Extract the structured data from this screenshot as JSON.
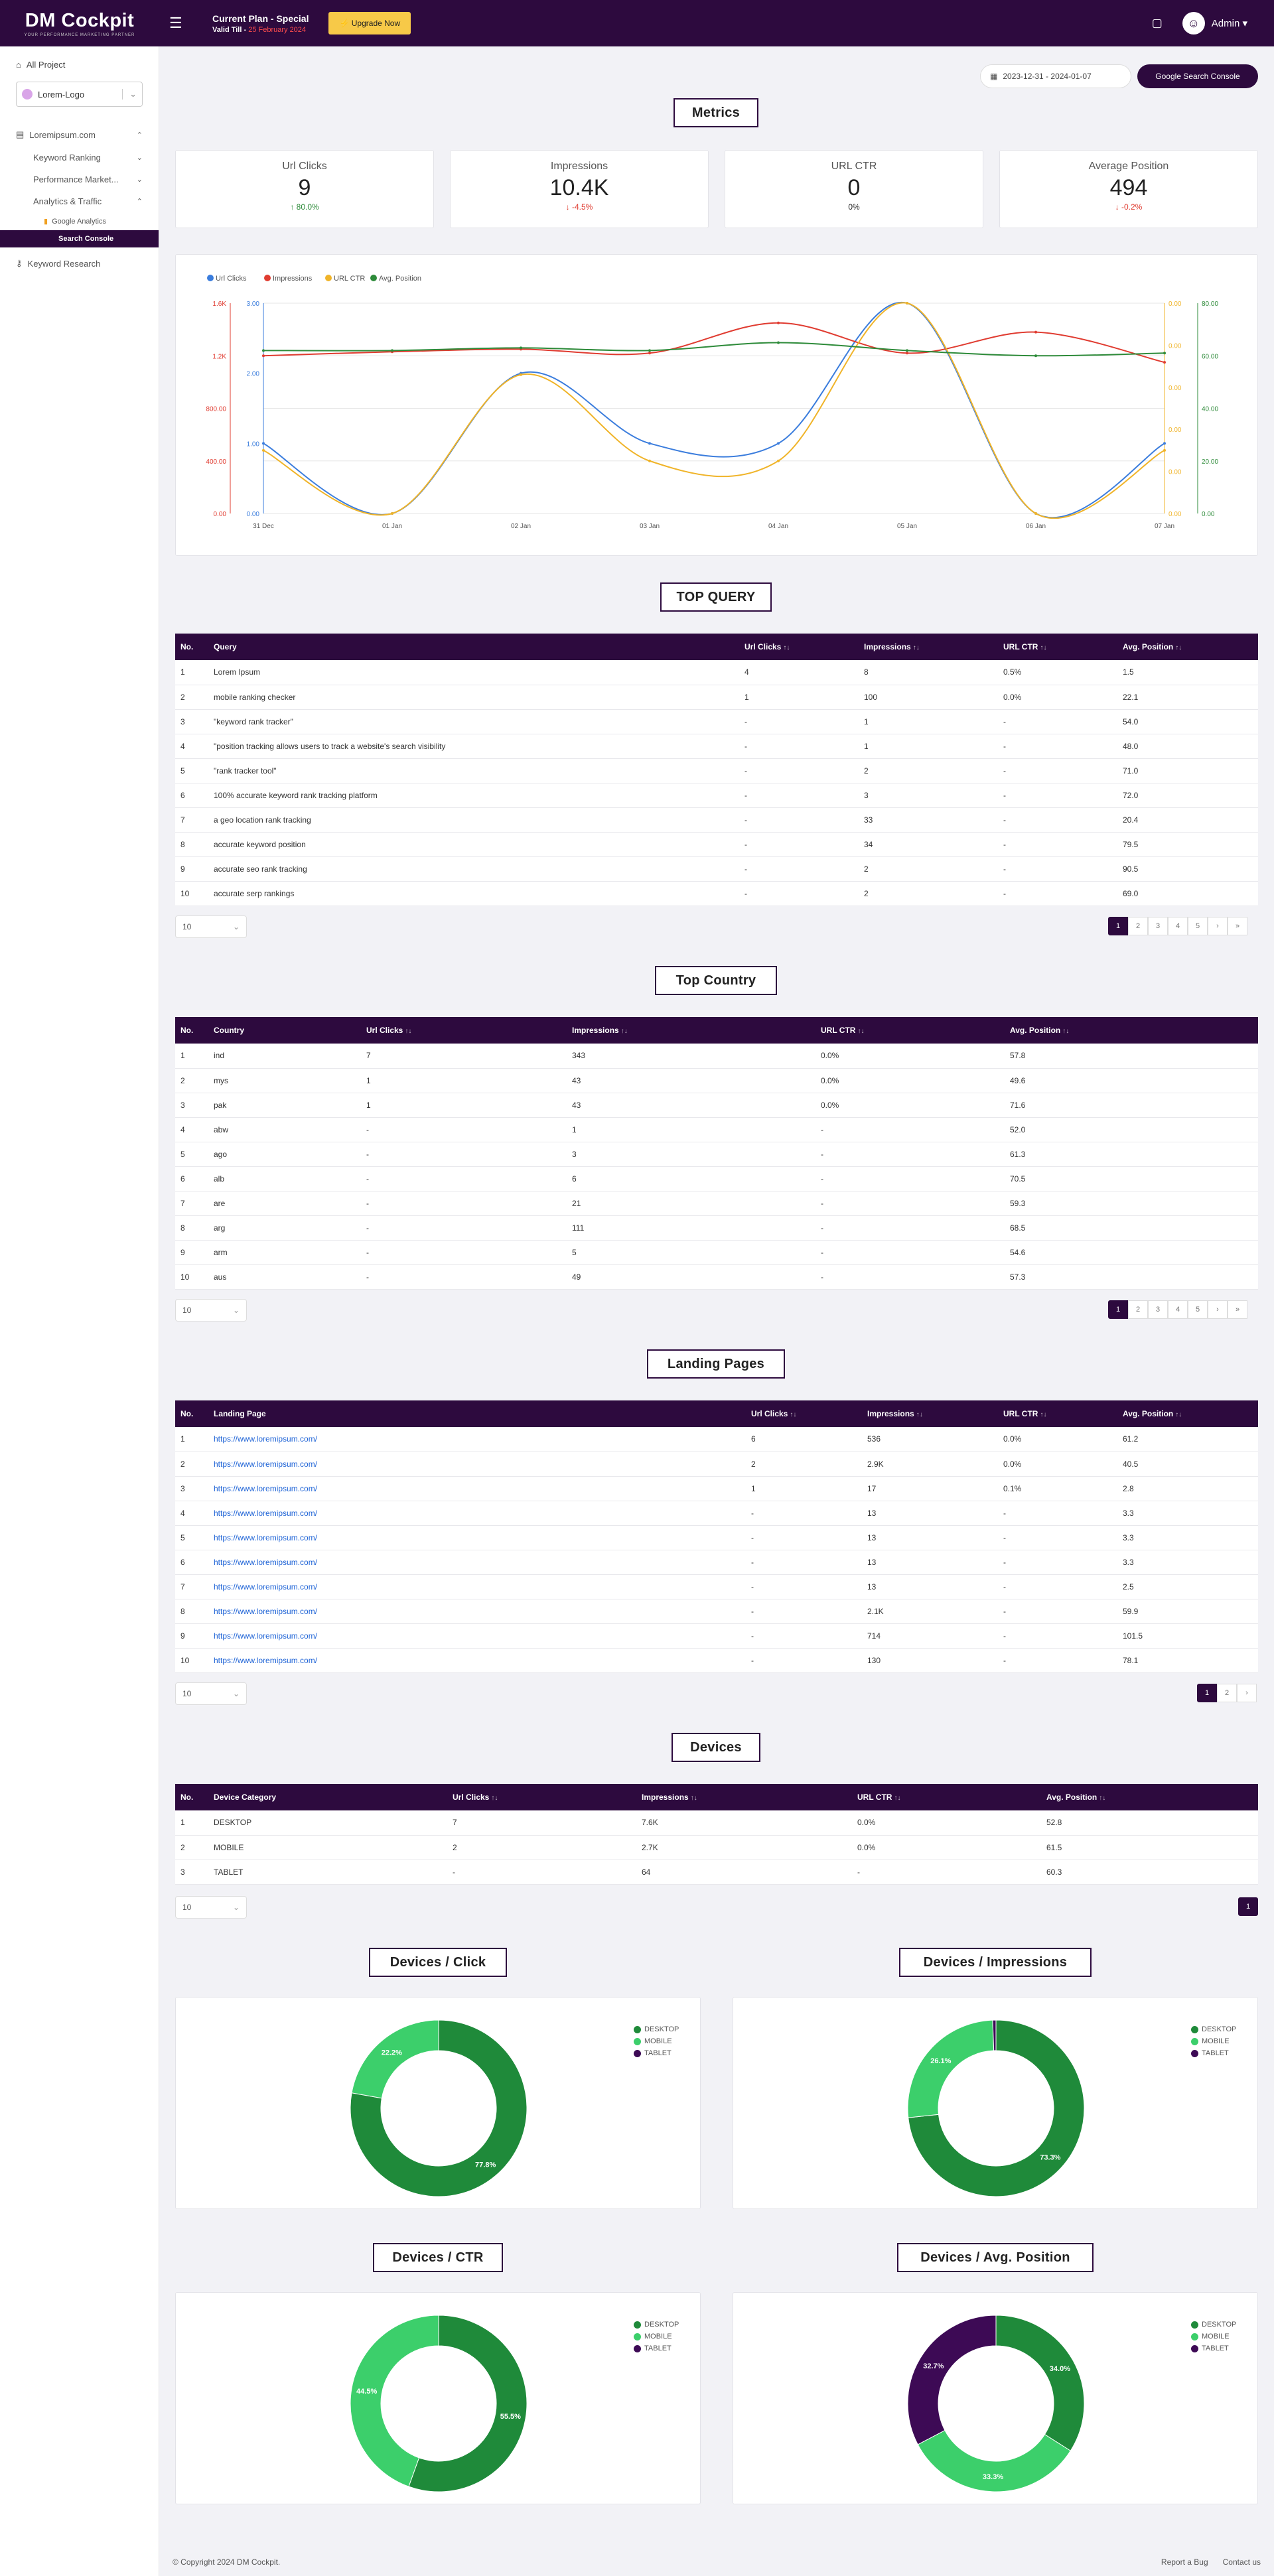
{
  "brand": {
    "name": "DM Cockpit",
    "tagline": "YOUR PERFORMANCE MARKETING PARTNER"
  },
  "header": {
    "plan_title": "Current Plan - Special",
    "valid_label": "Valid Till - ",
    "valid_date": "25 February 2024",
    "upgrade_label": "Upgrade Now",
    "message_icon": "chat-icon",
    "user": "Admin"
  },
  "sidebar": {
    "all_project": "All Project",
    "project_select": "Lorem-Logo",
    "site": "Loremipsum.com",
    "keyword_ranking": "Keyword Ranking",
    "performance_marketing": "Performance Market...",
    "analytics_traffic": "Analytics & Traffic",
    "google_analytics": "Google Analytics",
    "search_console": "Search Console",
    "keyword_research": "Keyword Research"
  },
  "toolbar": {
    "date_range": "2023-12-31 - 2024-01-07",
    "gsc_button": "Google Search Console"
  },
  "metrics": {
    "title": "Metrics",
    "items": [
      {
        "label": "Url Clicks",
        "value": "9",
        "change": "80.0%",
        "dir": "up"
      },
      {
        "label": "Impressions",
        "value": "10.4K",
        "change": "-4.5%",
        "dir": "down"
      },
      {
        "label": "URL CTR",
        "value": "0",
        "change": "0%",
        "dir": "flat"
      },
      {
        "label": "Average Position",
        "value": "494",
        "change": "-0.2%",
        "dir": "down"
      }
    ]
  },
  "chart_data": {
    "type": "line",
    "x": [
      "31 Dec",
      "01 Jan",
      "02 Jan",
      "03 Jan",
      "04 Jan",
      "05 Jan",
      "06 Jan",
      "07 Jan"
    ],
    "series": [
      {
        "name": "Url Clicks",
        "color": "#3b7ddd",
        "axis": "y1",
        "values": [
          1,
          0,
          2,
          1,
          1,
          3,
          0,
          1
        ]
      },
      {
        "name": "Impressions",
        "color": "#e03c31",
        "axis": "y0",
        "values": [
          1200,
          1230,
          1250,
          1220,
          1450,
          1220,
          1380,
          1150
        ]
      },
      {
        "name": "URL CTR",
        "color": "#f0b429",
        "axis": "y2",
        "values": [
          0.003,
          0,
          0.0066,
          0.0025,
          0.0025,
          0.01,
          0,
          0.003
        ]
      },
      {
        "name": "Avg. Position",
        "color": "#2e8b3a",
        "axis": "y3",
        "values": [
          62,
          62,
          63,
          62,
          65,
          62,
          60,
          61
        ]
      }
    ],
    "axes": {
      "y0": {
        "ticks": [
          "0.00",
          "400.00",
          "800.00",
          "1.2K",
          "1.6K"
        ],
        "max": 1600,
        "color": "#e03c31"
      },
      "y1": {
        "ticks": [
          "0.00",
          "1.00",
          "2.00",
          "3.00"
        ],
        "max": 3,
        "color": "#3b7ddd"
      },
      "y2": {
        "ticks": [
          "0.00",
          "0.00",
          "0.00",
          "0.00",
          "0.00",
          "0.00"
        ],
        "max": 0.01,
        "color": "#f0b429"
      },
      "y3": {
        "ticks": [
          "0.00",
          "20.00",
          "40.00",
          "60.00",
          "80.00"
        ],
        "max": 80,
        "color": "#2e8b3a"
      }
    },
    "grid": true,
    "legend": "top-left"
  },
  "top_query": {
    "title": "TOP QUERY",
    "columns": [
      "No.",
      "Query",
      "Url Clicks",
      "Impressions",
      "URL CTR",
      "Avg. Position"
    ],
    "rows": [
      [
        "1",
        "Lorem Ipsum",
        "4",
        "8",
        "0.5%",
        "1.5"
      ],
      [
        "2",
        "mobile ranking checker",
        "1",
        "100",
        "0.0%",
        "22.1"
      ],
      [
        "3",
        "\"keyword rank tracker\"",
        "-",
        "1",
        "-",
        "54.0"
      ],
      [
        "4",
        "\"position tracking allows users to track a website's search visibility",
        "-",
        "1",
        "-",
        "48.0"
      ],
      [
        "5",
        "\"rank tracker tool\"",
        "-",
        "2",
        "-",
        "71.0"
      ],
      [
        "6",
        "100% accurate keyword rank tracking platform",
        "-",
        "3",
        "-",
        "72.0"
      ],
      [
        "7",
        "a geo location rank tracking",
        "-",
        "33",
        "-",
        "20.4"
      ],
      [
        "8",
        "accurate keyword position",
        "-",
        "34",
        "-",
        "79.5"
      ],
      [
        "9",
        "accurate seo rank tracking",
        "-",
        "2",
        "-",
        "90.5"
      ],
      [
        "10",
        "accurate serp rankings",
        "-",
        "2",
        "-",
        "69.0"
      ]
    ],
    "page_size": "10",
    "pages": [
      "1",
      "2",
      "3",
      "4",
      "5",
      "›",
      "»"
    ]
  },
  "top_country": {
    "title": "Top Country",
    "columns": [
      "No.",
      "Country",
      "Url Clicks",
      "Impressions",
      "URL CTR",
      "Avg. Position"
    ],
    "rows": [
      [
        "1",
        "ind",
        "7",
        "343",
        "0.0%",
        "57.8"
      ],
      [
        "2",
        "mys",
        "1",
        "43",
        "0.0%",
        "49.6"
      ],
      [
        "3",
        "pak",
        "1",
        "43",
        "0.0%",
        "71.6"
      ],
      [
        "4",
        "abw",
        "-",
        "1",
        "-",
        "52.0"
      ],
      [
        "5",
        "ago",
        "-",
        "3",
        "-",
        "61.3"
      ],
      [
        "6",
        "alb",
        "-",
        "6",
        "-",
        "70.5"
      ],
      [
        "7",
        "are",
        "-",
        "21",
        "-",
        "59.3"
      ],
      [
        "8",
        "arg",
        "-",
        "111",
        "-",
        "68.5"
      ],
      [
        "9",
        "arm",
        "-",
        "5",
        "-",
        "54.6"
      ],
      [
        "10",
        "aus",
        "-",
        "49",
        "-",
        "57.3"
      ]
    ],
    "page_size": "10",
    "pages": [
      "1",
      "2",
      "3",
      "4",
      "5",
      "›",
      "»"
    ]
  },
  "landing_pages": {
    "title": "Landing Pages",
    "columns": [
      "No.",
      "Landing Page",
      "Url Clicks",
      "Impressions",
      "URL CTR",
      "Avg. Position"
    ],
    "rows": [
      [
        "1",
        "https://www.loremipsum.com/",
        "6",
        "536",
        "0.0%",
        "61.2"
      ],
      [
        "2",
        "https://www.loremipsum.com/",
        "2",
        "2.9K",
        "0.0%",
        "40.5"
      ],
      [
        "3",
        "https://www.loremipsum.com/",
        "1",
        "17",
        "0.1%",
        "2.8"
      ],
      [
        "4",
        "https://www.loremipsum.com/",
        "-",
        "13",
        "-",
        "3.3"
      ],
      [
        "5",
        "https://www.loremipsum.com/",
        "-",
        "13",
        "-",
        "3.3"
      ],
      [
        "6",
        "https://www.loremipsum.com/",
        "-",
        "13",
        "-",
        "3.3"
      ],
      [
        "7",
        "https://www.loremipsum.com/",
        "-",
        "13",
        "-",
        "2.5"
      ],
      [
        "8",
        "https://www.loremipsum.com/",
        "-",
        "2.1K",
        "-",
        "59.9"
      ],
      [
        "9",
        "https://www.loremipsum.com/",
        "-",
        "714",
        "-",
        "101.5"
      ],
      [
        "10",
        "https://www.loremipsum.com/",
        "-",
        "130",
        "-",
        "78.1"
      ]
    ],
    "page_size": "10",
    "pages": [
      "1",
      "2",
      "›"
    ]
  },
  "devices": {
    "title": "Devices",
    "columns": [
      "No.",
      "Device Category",
      "Url Clicks",
      "Impressions",
      "URL CTR",
      "Avg. Position"
    ],
    "rows": [
      [
        "1",
        "DESKTOP",
        "7",
        "7.6K",
        "0.0%",
        "52.8"
      ],
      [
        "2",
        "MOBILE",
        "2",
        "2.7K",
        "0.0%",
        "61.5"
      ],
      [
        "3",
        "TABLET",
        "-",
        "64",
        "-",
        "60.3"
      ]
    ],
    "page_size": "10",
    "pages": [
      "1"
    ]
  },
  "donuts": {
    "legend": [
      "DESKTOP",
      "MOBILE",
      "TABLET"
    ],
    "colors": [
      "#1f8a3a",
      "#3ccf6b",
      "#3d0a55"
    ],
    "charts": [
      {
        "title": "Devices / Click",
        "values": [
          77.8,
          22.2,
          0
        ],
        "labels": [
          "77.8%",
          "22.2%",
          ""
        ]
      },
      {
        "title": "Devices / Impressions",
        "values": [
          73.3,
          26.1,
          0.6
        ],
        "labels": [
          "73.3%",
          "26.1%",
          ""
        ]
      },
      {
        "title": "Devices / CTR",
        "values": [
          55.5,
          44.5,
          0
        ],
        "labels": [
          "55.5%",
          "44.5%",
          ""
        ]
      },
      {
        "title": "Devices / Avg. Position",
        "values": [
          34.0,
          33.3,
          32.7
        ],
        "labels": [
          "34.0%",
          "33.3%",
          "32.7%"
        ]
      }
    ]
  },
  "footer": {
    "copyright": "© Copyright 2024 DM Cockpit.",
    "report_bug": "Report a Bug",
    "contact": "Contact us"
  }
}
